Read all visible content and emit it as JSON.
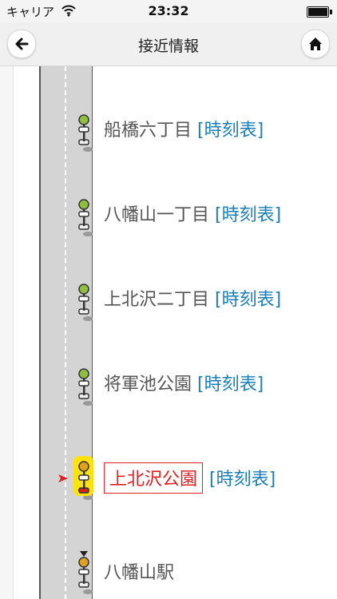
{
  "status_bar": {
    "carrier": "キャリア",
    "time": "23:32"
  },
  "nav": {
    "title": "接近情報",
    "back_icon": "back-arrow-icon",
    "home_icon": "home-icon"
  },
  "colors": {
    "timetable_link": "#1a7fb8",
    "current_highlight": "#e02020",
    "road": "#d4d4d4"
  },
  "stops": [
    {
      "name": "船橋六丁目",
      "timetable": "[時刻表]"
    },
    {
      "name": "八幡山一丁目",
      "timetable": "[時刻表]"
    },
    {
      "name": "上北沢二丁目",
      "timetable": "[時刻表]"
    },
    {
      "name": "将軍池公園",
      "timetable": "[時刻表]"
    },
    {
      "name": "上北沢公園",
      "timetable": "[時刻表]",
      "current": true
    },
    {
      "name": "八幡山駅",
      "timetable": ""
    }
  ]
}
